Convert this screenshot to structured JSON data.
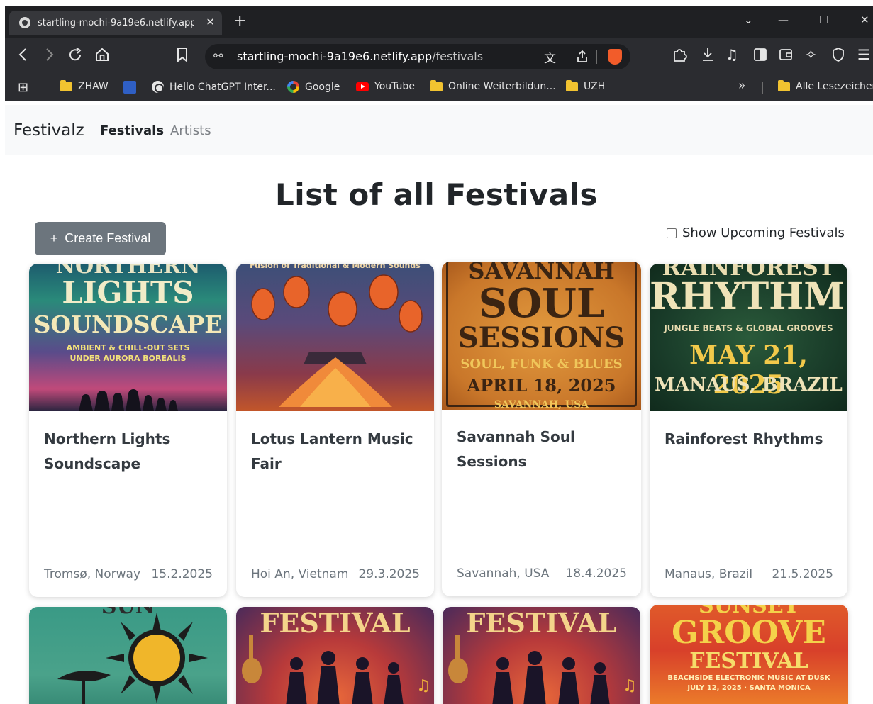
{
  "browser": {
    "tab_title": "startling-mochi-9a19e6.netlify.app",
    "tab_close": "✕",
    "new_tab": "+",
    "window_controls": [
      "⌄",
      "—",
      "☐",
      "✕"
    ],
    "url_domain": "startling-mochi-9a19e6.netlify.app",
    "url_path": "/festivals",
    "icons": [
      "back-icon",
      "forward-icon",
      "reload-icon",
      "home-icon",
      "bookmark-icon",
      "site-settings-icon",
      "translate-icon",
      "share-icon",
      "brave-shield-icon",
      "extensions-icon",
      "download-icon",
      "music-icon",
      "sidebar-icon",
      "wallet-icon",
      "leo-icon",
      "vpn-icon",
      "menu-icon"
    ],
    "bookmarks": [
      {
        "label": "ZHAW",
        "icon": "folder-icon"
      },
      {
        "label": "Hello ChatGPT Inter...",
        "icon": "chatgpt-icon"
      },
      {
        "label": "Google",
        "icon": "google-icon"
      },
      {
        "label": "YouTube",
        "icon": "youtube-icon"
      },
      {
        "label": "Online Weiterbildun...",
        "icon": "folder-icon"
      },
      {
        "label": "UZH",
        "icon": "folder-icon"
      }
    ],
    "bookmarks_overflow": "»",
    "all_bookmarks": "Alle Lesezeichen"
  },
  "nav": {
    "brand": "Festivalz",
    "links": [
      "Festivals",
      "Artists"
    ]
  },
  "main": {
    "title": "List of all Festivals",
    "create_button": "Create Festival",
    "create_plus": "+",
    "upcoming_label": "Show Upcoming Festivals"
  },
  "festivals": [
    {
      "title": "Northern Lights Soundscape",
      "location": "Tromsø, Norway",
      "date": "15.2.2025",
      "poster": {
        "top": "NORTHERN",
        "line1": "LIGHTS",
        "line2": "SOUNDSCAPE",
        "sub1": "AMBIENT & CHILL-OUT SETS",
        "sub2": "UNDER AURORA BOREALIS"
      }
    },
    {
      "title": "Lotus Lantern Music Fair",
      "location": "Hoi An, Vietnam",
      "date": "29.3.2025",
      "poster": {
        "top": "Fusion of Traditional & Modern Sounds"
      }
    },
    {
      "title": "Savannah Soul Sessions",
      "location": "Savannah, USA",
      "date": "18.4.2025",
      "poster": {
        "line0": "SAVANNAH",
        "line1": "SOUL",
        "line2": "SESSIONS",
        "sub1": "SOUL, FUNK & BLUES",
        "sub2": "APRIL 18, 2025",
        "sub3": "SAVANNAH, USA"
      }
    },
    {
      "title": "Rainforest Rhythms",
      "location": "Manaus, Brazil",
      "date": "21.5.2025",
      "poster": {
        "top": "RAINFOREST",
        "line1": "RHYTHMS",
        "sub1": "JUNGLE BEATS & GLOBAL GROOVES",
        "line2": "MAY 21, 2025",
        "line3": "MANAUS, BRAZIL"
      }
    }
  ],
  "second_row": [
    {
      "poster": {
        "top": "SUN"
      }
    },
    {
      "poster": {
        "line1": "FESTIVAL"
      }
    },
    {
      "poster": {
        "line1": "FESTIVAL"
      }
    },
    {
      "poster": {
        "top": "SUNSET",
        "line1": "GROOVE",
        "line2": "FESTIVAL",
        "sub1": "BEACHSIDE ELECTRONIC MUSIC AT DUSK",
        "sub2": "JULY 12, 2025 · SANTA MONICA"
      }
    }
  ]
}
